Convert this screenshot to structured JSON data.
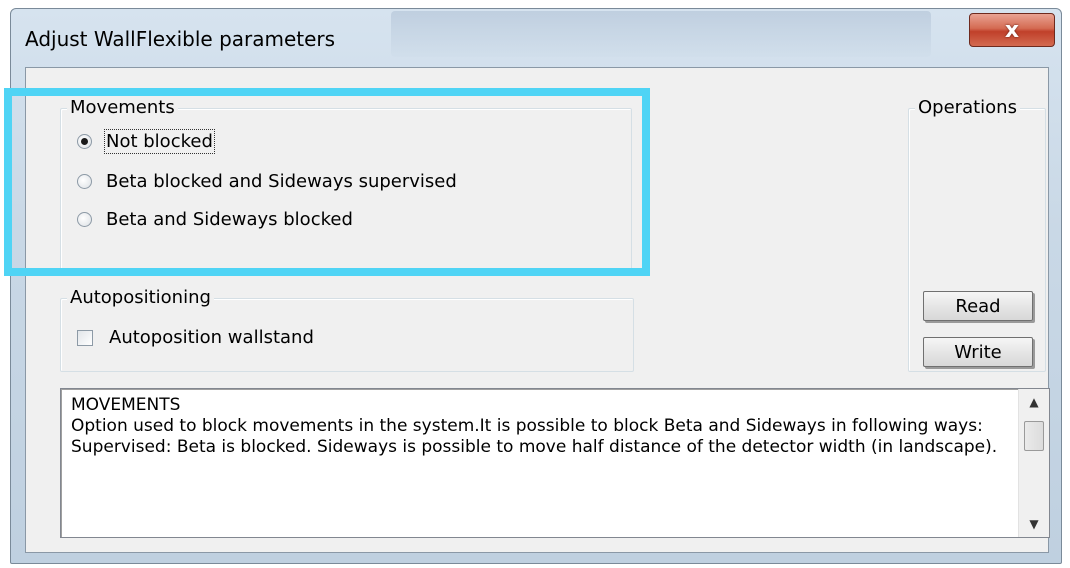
{
  "window": {
    "title": "Adjust WallFlexible parameters",
    "close_label": "x"
  },
  "movements": {
    "legend": "Movements",
    "options": [
      {
        "label": "Not blocked",
        "selected": true
      },
      {
        "label": "Beta blocked and Sideways supervised",
        "selected": false
      },
      {
        "label": "Beta and Sideways blocked",
        "selected": false
      }
    ]
  },
  "autopositioning": {
    "legend": "Autopositioning",
    "checkbox_label": "Autoposition wallstand",
    "checked": false
  },
  "operations": {
    "legend": "Operations",
    "read_label": "Read",
    "write_label": "Write"
  },
  "help_text": "MOVEMENTS\nOption used to block movements in the system.It is possible to block Beta and Sideways in following ways:\nSupervised: Beta is blocked. Sideways is possible to move half distance of the detector width (in landscape).",
  "colors": {
    "highlight": "#4fd4f5",
    "close_button": "#c9452e"
  },
  "icons": {
    "scroll_up": "arrow-up",
    "scroll_down": "arrow-down"
  }
}
